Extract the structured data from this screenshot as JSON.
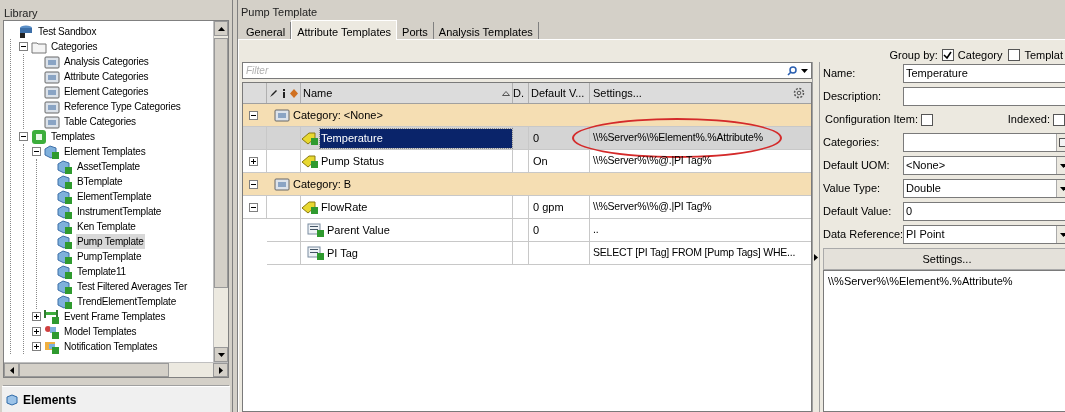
{
  "library": {
    "title": "Library",
    "tree": [
      {
        "label": "Test Sandbox",
        "kind": "database",
        "selected": false,
        "children": [
          {
            "label": "Categories",
            "kind": "folder",
            "expanded": true,
            "selected": false,
            "children": [
              {
                "label": "Analysis Categories",
                "kind": "category",
                "selected": false
              },
              {
                "label": "Attribute Categories",
                "kind": "category",
                "selected": false
              },
              {
                "label": "Element Categories",
                "kind": "category",
                "selected": false
              },
              {
                "label": "Reference Type Categories",
                "kind": "category",
                "selected": false
              },
              {
                "label": "Table Categories",
                "kind": "category",
                "selected": false
              }
            ]
          },
          {
            "label": "Templates",
            "kind": "templates",
            "expanded": true,
            "selected": false,
            "children": [
              {
                "label": "Element Templates",
                "kind": "template",
                "expanded": true,
                "selected": false,
                "children": [
                  {
                    "label": "AssetTemplate",
                    "kind": "template",
                    "selected": false
                  },
                  {
                    "label": "BTemplate",
                    "kind": "template",
                    "selected": false
                  },
                  {
                    "label": "ElementTemplate",
                    "kind": "template",
                    "selected": false
                  },
                  {
                    "label": "InstrumentTemplate",
                    "kind": "template",
                    "selected": false
                  },
                  {
                    "label": "Ken Template",
                    "kind": "template",
                    "selected": false
                  },
                  {
                    "label": "Pump Template",
                    "kind": "template",
                    "selected": true
                  },
                  {
                    "label": "PumpTemplate",
                    "kind": "template",
                    "selected": false
                  },
                  {
                    "label": "Template11",
                    "kind": "template",
                    "selected": false
                  },
                  {
                    "label": "Test Filtered Averages Ter",
                    "kind": "template",
                    "selected": false
                  },
                  {
                    "label": "TrendElementTemplate",
                    "kind": "template",
                    "selected": false
                  }
                ]
              },
              {
                "label": "Event Frame Templates",
                "kind": "event-frame",
                "expanded": false,
                "selected": false
              },
              {
                "label": "Model Templates",
                "kind": "model",
                "expanded": false,
                "selected": false
              },
              {
                "label": "Notification Templates",
                "kind": "notification",
                "expanded": false,
                "selected": false
              }
            ]
          }
        ]
      }
    ],
    "bottom_tab": "Elements"
  },
  "editor": {
    "title": "Pump Template",
    "tabs": [
      {
        "label": "General",
        "selected": false
      },
      {
        "label": "Attribute Templates",
        "selected": true
      },
      {
        "label": "Ports",
        "selected": false
      },
      {
        "label": "Analysis Templates",
        "selected": false
      }
    ],
    "filter": {
      "placeholder": "Filter"
    },
    "table": {
      "columns": [
        "Name",
        "D.",
        "Default V...",
        "Settings..."
      ],
      "rows": [
        {
          "kind": "category",
          "label": "Category: <None>",
          "expanded": true,
          "children": [
            {
              "kind": "attribute",
              "name": "Temperature",
              "default_value": "0",
              "settings": "\\\\%Server%\\%Element%.%Attribute%",
              "selected": true
            },
            {
              "kind": "attribute",
              "name": "Pump Status",
              "default_value": "On",
              "settings": "\\\\%Server%\\%@.|PI Tag%",
              "selected": false,
              "expanded": false
            }
          ]
        },
        {
          "kind": "category",
          "label": "Category: B",
          "expanded": true,
          "children": [
            {
              "kind": "attribute",
              "name": "FlowRate",
              "default_value": "0 gpm",
              "settings": "\\\\%Server%\\%@.|PI Tag%",
              "selected": false,
              "expanded": true,
              "children": [
                {
                  "kind": "child",
                  "name": "Parent Value",
                  "default_value": "0",
                  "settings": "..",
                  "selected": false
                },
                {
                  "kind": "child",
                  "name": "PI Tag",
                  "settings": "SELECT [PI Tag] FROM [Pump Tags] WHE...",
                  "selected": false
                }
              ]
            }
          ]
        }
      ]
    }
  },
  "properties": {
    "group_by": {
      "label": "Group by:",
      "options": [
        {
          "label": "Category",
          "checked": true
        },
        {
          "label": "Templat",
          "checked": false
        }
      ]
    },
    "fields": [
      {
        "kind": "text",
        "label": "Name:",
        "value": "Temperature"
      },
      {
        "kind": "text",
        "label": "Description:"
      },
      {
        "kind": "checks",
        "label": "Configuration Item:",
        "checked": false,
        "label_2": "Indexed:",
        "checked_2": false
      },
      {
        "kind": "lookup",
        "label": "Categories:"
      },
      {
        "kind": "dropdown",
        "label": "Default UOM:",
        "value": "<None>"
      },
      {
        "kind": "dropdown",
        "label": "Value Type:",
        "value": "Double"
      },
      {
        "kind": "text",
        "label": "Default Value:",
        "value": "0"
      },
      {
        "kind": "dropdown",
        "label": "Data Reference:",
        "value": "PI Point"
      }
    ],
    "settings_button": "Settings...",
    "settings_text": "\\\\%Server%\\%Element%.%Attribute%"
  }
}
